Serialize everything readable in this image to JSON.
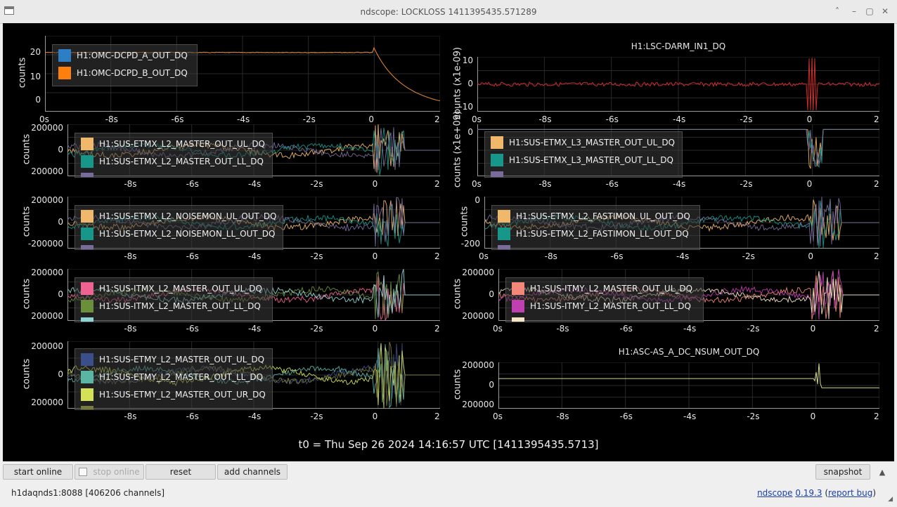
{
  "window": {
    "title": "ndscope: LOCKLOSS 1411395435.571289",
    "controls": [
      "˄",
      "–",
      "▢",
      "✕"
    ]
  },
  "t0_label": "t0 = Thu Sep 26 2024 14:16:57 UTC [1411395435.5713]",
  "buttons": {
    "start_online": "start online",
    "stop_online": "stop online",
    "reset": "reset",
    "add_channels": "add channels",
    "snapshot": "snapshot",
    "collapse": "▲"
  },
  "status": {
    "server": "h1daqnds1:8088  [406206 channels]",
    "app": "ndscope",
    "version": "0.19.3",
    "report": "report bug"
  },
  "colors": {
    "grid": "#2a2a2a",
    "axis": "#9a9a9a",
    "text": "#e8e8e8"
  },
  "chart_data": [
    {
      "id": "omc",
      "type": "line",
      "ylabel": "counts",
      "title": "",
      "xticks": [
        "0s",
        "-8s",
        "-6s",
        "-4s",
        "-2s",
        "0",
        "2"
      ],
      "yticks": [
        "20",
        "10",
        "0"
      ],
      "series": [
        {
          "name": "H1:OMC-DCPD_A_OUT_DQ",
          "color": "#2c7fc4"
        },
        {
          "name": "H1:OMC-DCPD_B_OUT_DQ",
          "color": "#ff7f0e"
        }
      ]
    },
    {
      "id": "darm",
      "type": "line",
      "ylabel": "counts (x1e-09)",
      "title": "H1:LSC-DARM_IN1_DQ",
      "xticks": [
        "0s",
        "-8s",
        "-6s",
        "-4s",
        "-2s",
        "0",
        "2"
      ],
      "yticks": [
        "10",
        "0",
        "-10"
      ],
      "series": [
        {
          "name": "H1:LSC-DARM_IN1_DQ",
          "color": "#e03030"
        }
      ]
    },
    {
      "id": "etmx_l2_master",
      "type": "line",
      "ylabel": "counts",
      "title": "",
      "xticks": [
        "-8s",
        "-6s",
        "-4s",
        "-2s",
        "0",
        "2"
      ],
      "yticks": [
        "200000",
        "0",
        "200000"
      ],
      "series": [
        {
          "name": "H1:SUS-ETMX_L2_MASTER_OUT_UL_DQ",
          "color": "#f0b86a"
        },
        {
          "name": "H1:SUS-ETMX_L2_MASTER_OUT_LL_DQ",
          "color": "#17968a"
        },
        {
          "name": "",
          "color": "#7a6c9a"
        }
      ]
    },
    {
      "id": "etmx_l3_master",
      "type": "line",
      "ylabel": "counts (x1e+09)",
      "title": "",
      "xticks": [
        "0s",
        "-8s",
        "-6s",
        "-4s",
        "-2s",
        "0",
        "2"
      ],
      "yticks": [
        "0"
      ],
      "series": [
        {
          "name": "H1:SUS-ETMX_L3_MASTER_OUT_UL_DQ",
          "color": "#f0b86a"
        },
        {
          "name": "H1:SUS-ETMX_L3_MASTER_OUT_LL_DQ",
          "color": "#17968a"
        },
        {
          "name": "",
          "color": "#7a6c9a"
        }
      ]
    },
    {
      "id": "etmx_l2_noisemon",
      "type": "line",
      "ylabel": "counts",
      "title": "",
      "xticks": [
        "-8s",
        "-6s",
        "-4s",
        "-2s",
        "0",
        "2"
      ],
      "yticks": [
        "200000",
        "0",
        "-200000"
      ],
      "series": [
        {
          "name": "H1:SUS-ETMX_L2_NOISEMON_UL_OUT_DQ",
          "color": "#f0b86a"
        },
        {
          "name": "H1:SUS-ETMX_L2_NOISEMON_LL_OUT_DQ",
          "color": "#17968a"
        },
        {
          "name": "",
          "color": "#7a6c9a"
        }
      ]
    },
    {
      "id": "etmx_l2_fastimon",
      "type": "line",
      "ylabel": "counts",
      "title": "",
      "xticks": [
        "0s",
        "-8s",
        "-6s",
        "-4s",
        "-2s",
        "0",
        "2"
      ],
      "yticks": [
        "0",
        "-200"
      ],
      "series": [
        {
          "name": "H1:SUS-ETMX_L2_FASTIMON_UL_OUT_DQ",
          "color": "#f0b86a"
        },
        {
          "name": "H1:SUS-ETMX_L2_FASTIMON_LL_OUT_DQ",
          "color": "#17968a"
        },
        {
          "name": "",
          "color": "#7a6c9a"
        }
      ]
    },
    {
      "id": "itmx_l2_master",
      "type": "line",
      "ylabel": "counts",
      "title": "",
      "xticks": [
        "-8s",
        "-6s",
        "-4s",
        "-2s",
        "0",
        "2"
      ],
      "yticks": [
        "200000",
        "0",
        "200000"
      ],
      "series": [
        {
          "name": "H1:SUS-ITMX_L2_MASTER_OUT_UL_DQ",
          "color": "#f06292"
        },
        {
          "name": "H1:SUS-ITMX_L2_MASTER_OUT_LL_DQ",
          "color": "#6b8e3a"
        },
        {
          "name": "",
          "color": "#8fd3d3"
        }
      ]
    },
    {
      "id": "itmy_l2_master",
      "type": "line",
      "ylabel": "counts",
      "title": "",
      "xticks": [
        "0s",
        "-8s",
        "-6s",
        "-4s",
        "-2s",
        "0",
        "2"
      ],
      "yticks": [
        "200000",
        "0",
        "200000"
      ],
      "series": [
        {
          "name": "H1:SUS-ITMY_L2_MASTER_OUT_UL_DQ",
          "color": "#f2877a"
        },
        {
          "name": "H1:SUS-ITMY_L2_MASTER_OUT_LL_DQ",
          "color": "#c040b0"
        },
        {
          "name": "",
          "color": "#f5e6c8"
        }
      ]
    },
    {
      "id": "etmy_l2_master",
      "type": "line",
      "ylabel": "counts",
      "title": "",
      "xticks": [
        "-8s",
        "-6s",
        "-4s",
        "-2s",
        "0",
        "2"
      ],
      "yticks": [
        "200000",
        "0",
        "200000"
      ],
      "series": [
        {
          "name": "H1:SUS-ETMY_L2_MASTER_OUT_UL_DQ",
          "color": "#3a4f8a"
        },
        {
          "name": "H1:SUS-ETMY_L2_MASTER_OUT_LL_DQ",
          "color": "#5bb5a5"
        },
        {
          "name": "H1:SUS-ETMY_L2_MASTER_OUT_UR_DQ",
          "color": "#d4e157"
        },
        {
          "name": "",
          "color": "#7a7a3a"
        }
      ]
    },
    {
      "id": "asc_as_a",
      "type": "line",
      "ylabel": "counts",
      "title": "H1:ASC-AS_A_DC_NSUM_OUT_DQ",
      "xticks": [
        "0s",
        "-8s",
        "-6s",
        "-4s",
        "-2s",
        "0",
        "2"
      ],
      "yticks": [
        "200000",
        "0",
        "200000"
      ],
      "series": [
        {
          "name": "H1:ASC-AS_A_DC_NSUM_OUT_DQ",
          "color": "#e6ee9c"
        }
      ]
    }
  ]
}
